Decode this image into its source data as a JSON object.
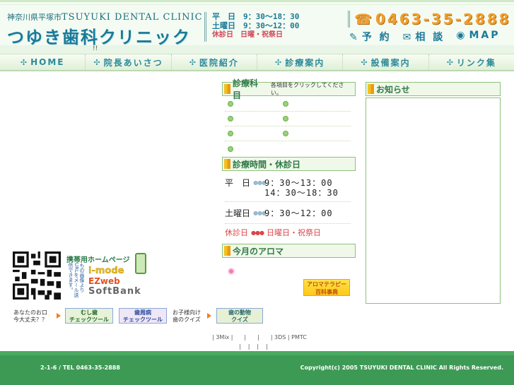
{
  "header": {
    "location": "神奈川県平塚市",
    "clinic_en": "TSUYUKI DENTAL CLINIC",
    "clinic_ja": "つゆき歯科クリニック",
    "hours": {
      "weekday_label": "平　日",
      "weekday_time": "9：30～18：30",
      "saturday_label": "土曜日",
      "saturday_time": "9：30～12：00",
      "closed_label": "休診日",
      "closed_days": "日曜・祝祭日"
    },
    "phone": "0463-35-2888",
    "links": [
      {
        "label": "予 約",
        "icon": "pen-icon"
      },
      {
        "label": "相 談",
        "icon": "mail-icon"
      },
      {
        "label": "MAP",
        "icon": "globe-icon"
      }
    ]
  },
  "nav_separator_mark": "!!",
  "nav": [
    {
      "label": "HOME"
    },
    {
      "label": "院長あいさつ"
    },
    {
      "label": "医院紹介"
    },
    {
      "label": "診療案内"
    },
    {
      "label": "設備案内"
    },
    {
      "label": "リンク集"
    }
  ],
  "sections": {
    "medical": {
      "title": "診療科目",
      "note": "各項目をクリックしてください。"
    },
    "hours": {
      "title": "診療時間・休診日"
    },
    "aroma": {
      "title": "今月のアロマ",
      "button_line1": "アロマテラピー",
      "button_line2": "百科事典"
    },
    "news": {
      "title": "お知らせ"
    }
  },
  "hours_table": {
    "weekday_label": "平　日",
    "weekday_time1": "9：30～13：00",
    "weekday_time2": "14：30～18：30",
    "saturday_label": "土曜日",
    "saturday_time": "9：30～12：00",
    "closed_label": "休診日",
    "closed_days": "日曜日・祝祭日"
  },
  "mobile": {
    "title": "携帯用ホームページ",
    "vertical_text": "もの画像より　URLをメール送信できます。",
    "carriers": [
      "i-mode",
      "EZweb",
      "SoftBank"
    ]
  },
  "quiz": {
    "q1_text_1": "あなたのお口",
    "q1_text_2": "今大丈夫？？",
    "q1_img_1": "むし歯",
    "q1_img_2": "チェックツール",
    "q2_img_1": "歯周病",
    "q2_img_2": "チェックツール",
    "q3_text_1": "お子様向け",
    "q3_text_2": "歯のクイズ",
    "q3_img_1": "歯の動物",
    "q3_img_2": "クイズ"
  },
  "footer": {
    "link_row1": "| 3Mix |　　|　　|　　| 3DS | PMTC",
    "link_row2": "||||",
    "address": "2-1-6 / TEL 0463-35-2888",
    "copyright": "Copyright(c) 2005 TSUYUKI DENTAL CLINIC All Rights Reserved."
  },
  "colors": {
    "brand_teal": "#1a7a99",
    "accent_orange": "#f0a030",
    "section_green": "#8dc27a",
    "footer_green": "#3d9a55",
    "closed_red": "#d9464a"
  }
}
